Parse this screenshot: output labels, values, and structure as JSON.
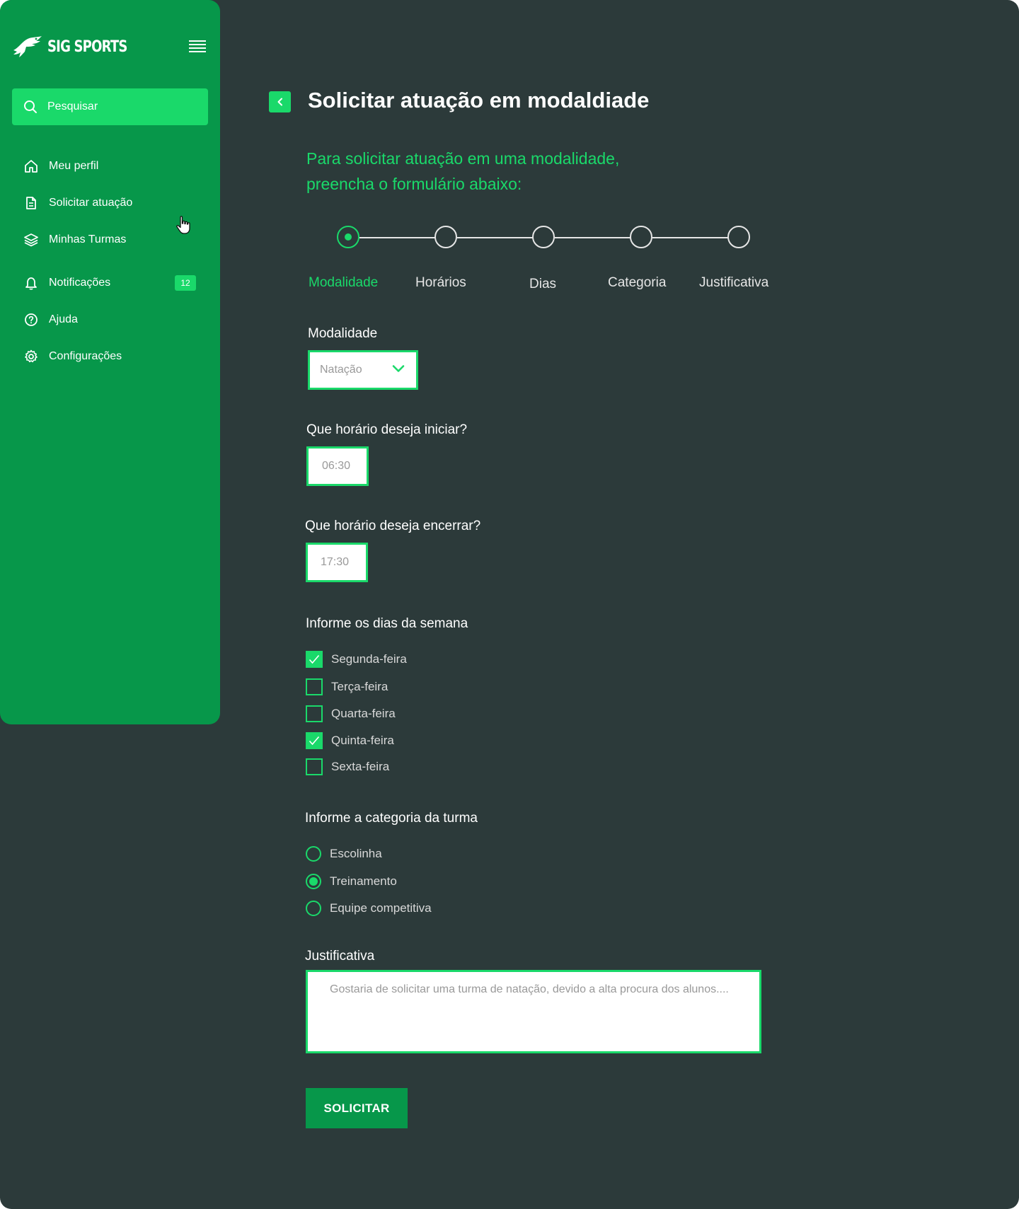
{
  "app": {
    "brand": "SIG SPORTS"
  },
  "colors": {
    "sidebar": "#07974a",
    "accent": "#1ad96a",
    "background": "#2c3a3a"
  },
  "sidebar": {
    "search_label": "Pesquisar",
    "items": [
      {
        "label": "Meu perfil",
        "icon": "home-icon"
      },
      {
        "label": "Solicitar atuação",
        "icon": "document-icon"
      },
      {
        "label": "Minhas Turmas",
        "icon": "layers-icon"
      },
      {
        "label": "Notificações",
        "icon": "bell-icon",
        "badge": "12"
      },
      {
        "label": "Ajuda",
        "icon": "help-icon"
      },
      {
        "label": "Configurações",
        "icon": "gear-icon"
      }
    ]
  },
  "page": {
    "title": "Solicitar atuação em modaldiade",
    "subtitle_line1": "Para solicitar atuação em uma modalidade,",
    "subtitle_line2": "preencha o formulário abaixo:"
  },
  "stepper": {
    "steps": [
      "Modalidade",
      "Horários",
      "Dias",
      "Categoria",
      "Justificativa"
    ],
    "active_index": 0
  },
  "form": {
    "modalidade_label": "Modalidade",
    "modalidade_value": "Natação",
    "start_label": "Que horário deseja iniciar?",
    "start_value": "06:30",
    "end_label": "Que horário deseja encerrar?",
    "end_value": "17:30",
    "days_label": "Informe os dias da semana",
    "days": [
      {
        "label": "Segunda-feira",
        "checked": true
      },
      {
        "label": "Terça-feira",
        "checked": false
      },
      {
        "label": "Quarta-feira",
        "checked": false
      },
      {
        "label": "Quinta-feira",
        "checked": true
      },
      {
        "label": "Sexta-feira",
        "checked": false
      }
    ],
    "category_label": "Informe a categoria da turma",
    "categories": [
      {
        "label": "Escolinha",
        "checked": false
      },
      {
        "label": "Treinamento",
        "checked": true
      },
      {
        "label": "Equipe competitiva",
        "checked": false
      }
    ],
    "justification_label": "Justificativa",
    "justification_placeholder": "Gostaria de solicitar uma turma de natação, devido a alta procura dos alunos....",
    "submit_label": "SOLICITAR"
  }
}
